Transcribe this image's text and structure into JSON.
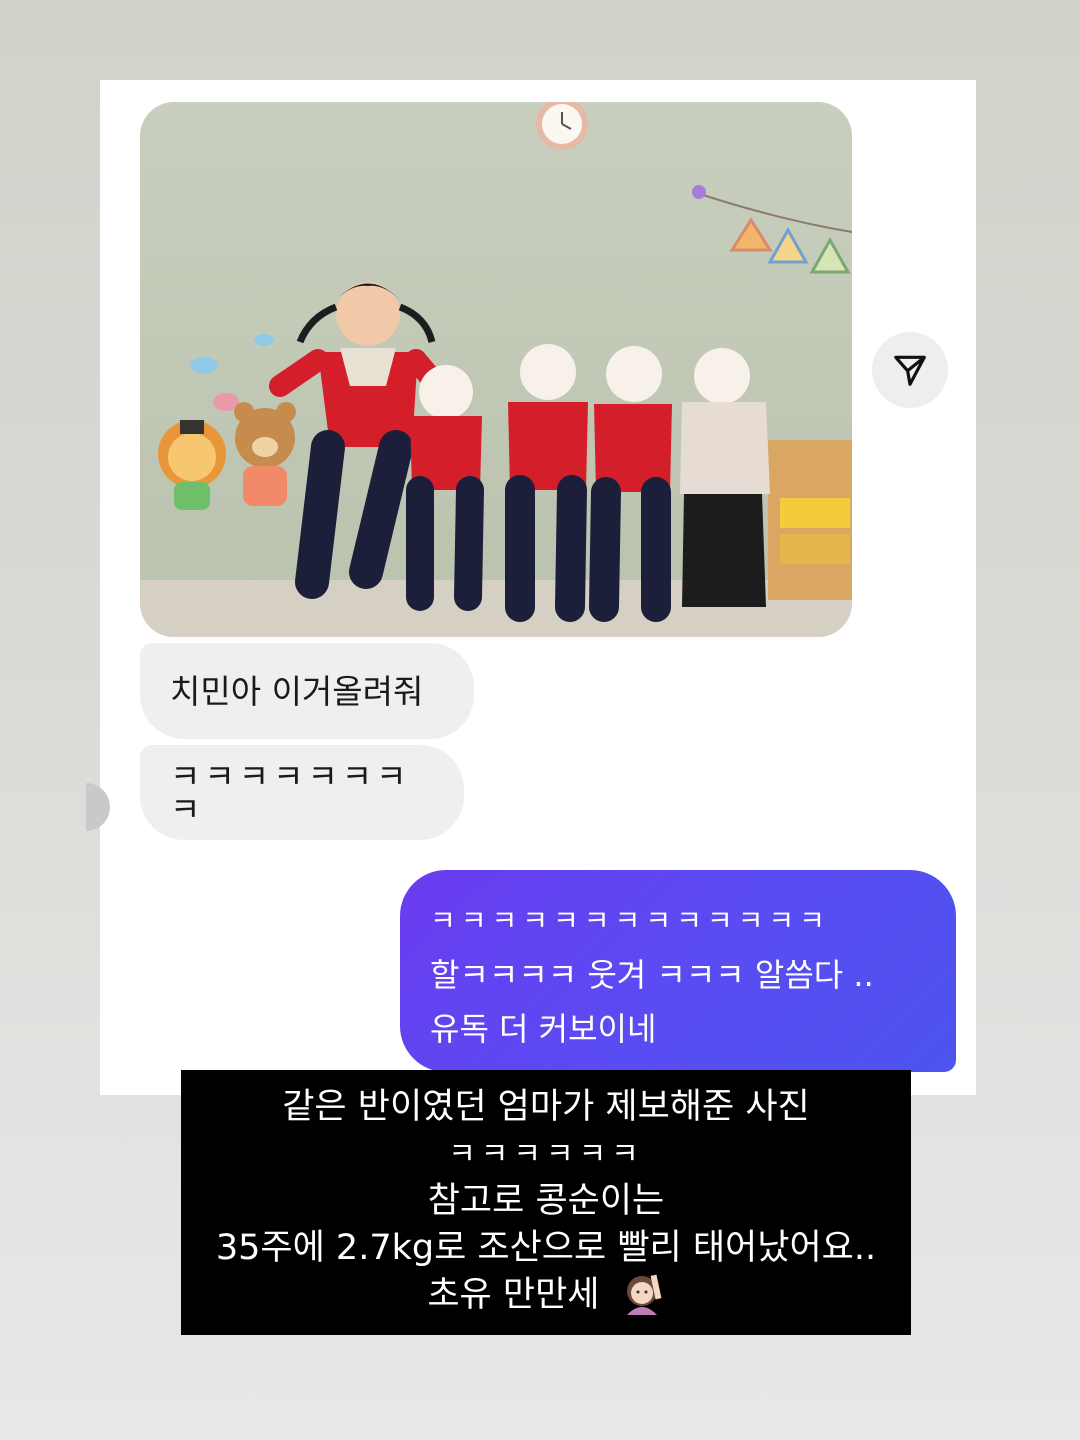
{
  "conversation": {
    "photo_alt": "Five children in red uniforms posing in front of a classroom wall",
    "incoming": [
      {
        "text": "치민아 이거올려줘"
      },
      {
        "text": "ㅋㅋㅋㅋㅋㅋㅋㅋ"
      }
    ],
    "outgoing": {
      "lines": [
        "ㅋㅋㅋㅋㅋㅋㅋㅋㅋㅋㅋㅋㅋ",
        "할ㅋㅋㅋㅋ 웃겨 ㅋㅋㅋ 알씀다 ..",
        "유독 더 커보이네"
      ]
    },
    "share_icon": "send-paper-plane-icon"
  },
  "caption": {
    "lines": [
      "같은 반이였던 엄마가 제보해준 사진",
      "ㅋㅋㅋㅋㅋㅋ",
      "참고로 콩순이는",
      "35주에 2.7kg로 조산으로 빨리 태어났어요..",
      "초유 만만세"
    ],
    "emoji": "woman-raising-hand-emoji"
  },
  "colors": {
    "outgoing_bubble": "#5a4bf2",
    "incoming_bubble": "#efefef",
    "caption_bg": "#000000"
  }
}
